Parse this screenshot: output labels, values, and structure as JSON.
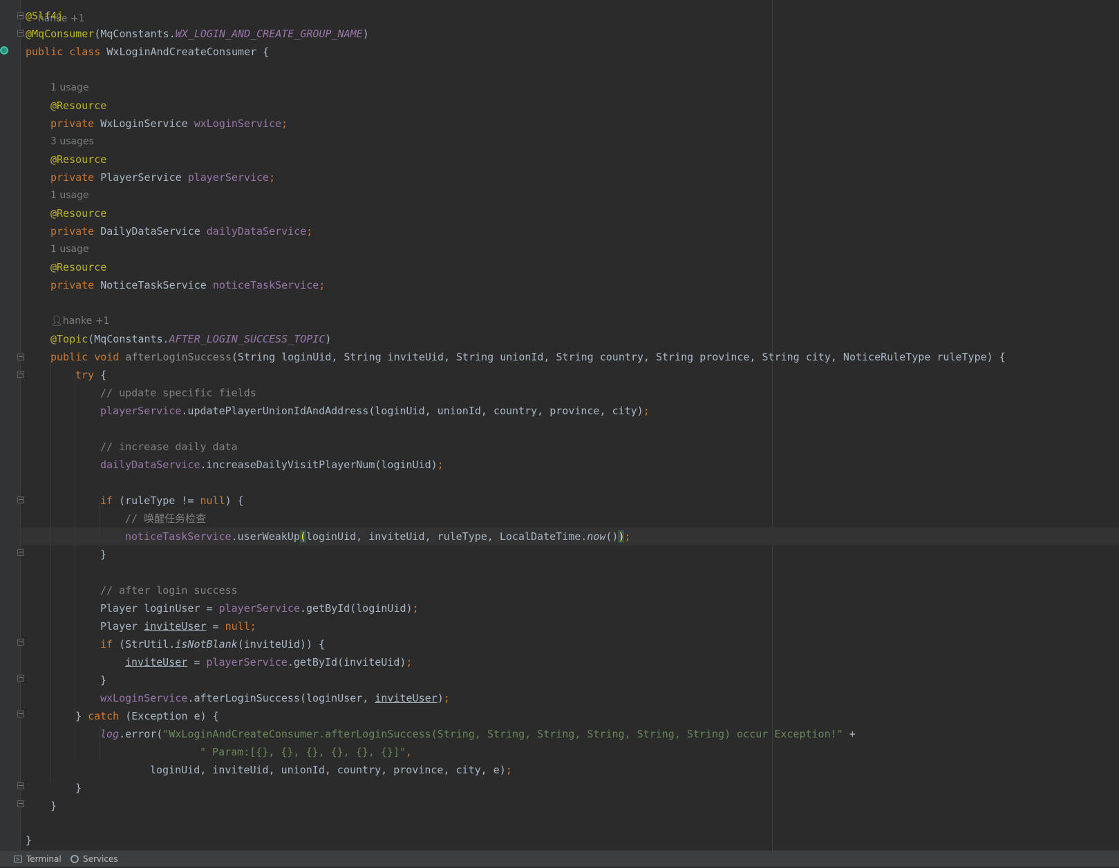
{
  "editor": {
    "top_author_hint": "hanke +1",
    "class_annotation_1": "@Slf4j",
    "class_annotation_2": "@MqConsumer",
    "mq_constants": "MqConstants.",
    "group_name_const": "WX_LOGIN_AND_CREATE_GROUP_NAME",
    "class_name": "WxLoginAndCreateConsumer",
    "fields": [
      {
        "usage": "1 usage",
        "annotation": "@Resource",
        "type": "WxLoginService",
        "name": "wxLoginService"
      },
      {
        "usage": "3 usages",
        "annotation": "@Resource",
        "type": "PlayerService",
        "name": "playerService"
      },
      {
        "usage": "1 usage",
        "annotation": "@Resource",
        "type": "DailyDataService",
        "name": "dailyDataService"
      },
      {
        "usage": "1 usage",
        "annotation": "@Resource",
        "type": "NoticeTaskService",
        "name": "noticeTaskService"
      }
    ],
    "method_author_hint": "hanke +1",
    "topic_annotation": "@Topic",
    "topic_const": "AFTER_LOGIN_SUCCESS_TOPIC",
    "method_name": "afterLoginSuccess",
    "method_params": "(String loginUid, String inviteUid, String unionId, String country, String province, String city, NoticeRuleType ruleType) {",
    "comment_update": "// update specific fields",
    "update_call": ".updatePlayerUnionIdAndAddress(loginUid, unionId, country, province, city)",
    "comment_daily": "// increase daily data",
    "daily_call": ".increaseDailyVisitPlayerNum(loginUid)",
    "comment_wakeup": "// 唤醒任务检查",
    "wakeup_method": "userWeakUp",
    "wakeup_args": "loginUid, inviteUid, ruleType, LocalDateTime.",
    "now": "now",
    "comment_after": "// after login success",
    "player_type": "Player",
    "login_user_var": "loginUser",
    "invite_user_var": "inviteUser",
    "get_by_id": ".getById",
    "str_util": "StrUtil.",
    "is_not_blank": "isNotBlank",
    "after_login_call": ".afterLoginSuccess(loginUser, ",
    "exception_type": "(Exception e) {",
    "log_var": "log",
    "error_call": ".error(",
    "error_msg_1": "\"WxLoginAndCreateConsumer.afterLoginSuccess(String, String, String, String, String, String) occur Exception!\"",
    "error_msg_2": "\" Param:[{}, {}, {}, {}, {}, {}]\"",
    "error_args": "loginUid, inviteUid, unionId, country, province, city, e)"
  },
  "status_bar": {
    "terminal_label": "Terminal",
    "services_label": "Services"
  },
  "colors": {
    "background": "#2b2b2b",
    "keyword": "#cc7832",
    "annotation": "#bbb529",
    "string": "#6a8759",
    "field": "#9876aa",
    "comment": "#808080",
    "text": "#a9b7c6"
  }
}
